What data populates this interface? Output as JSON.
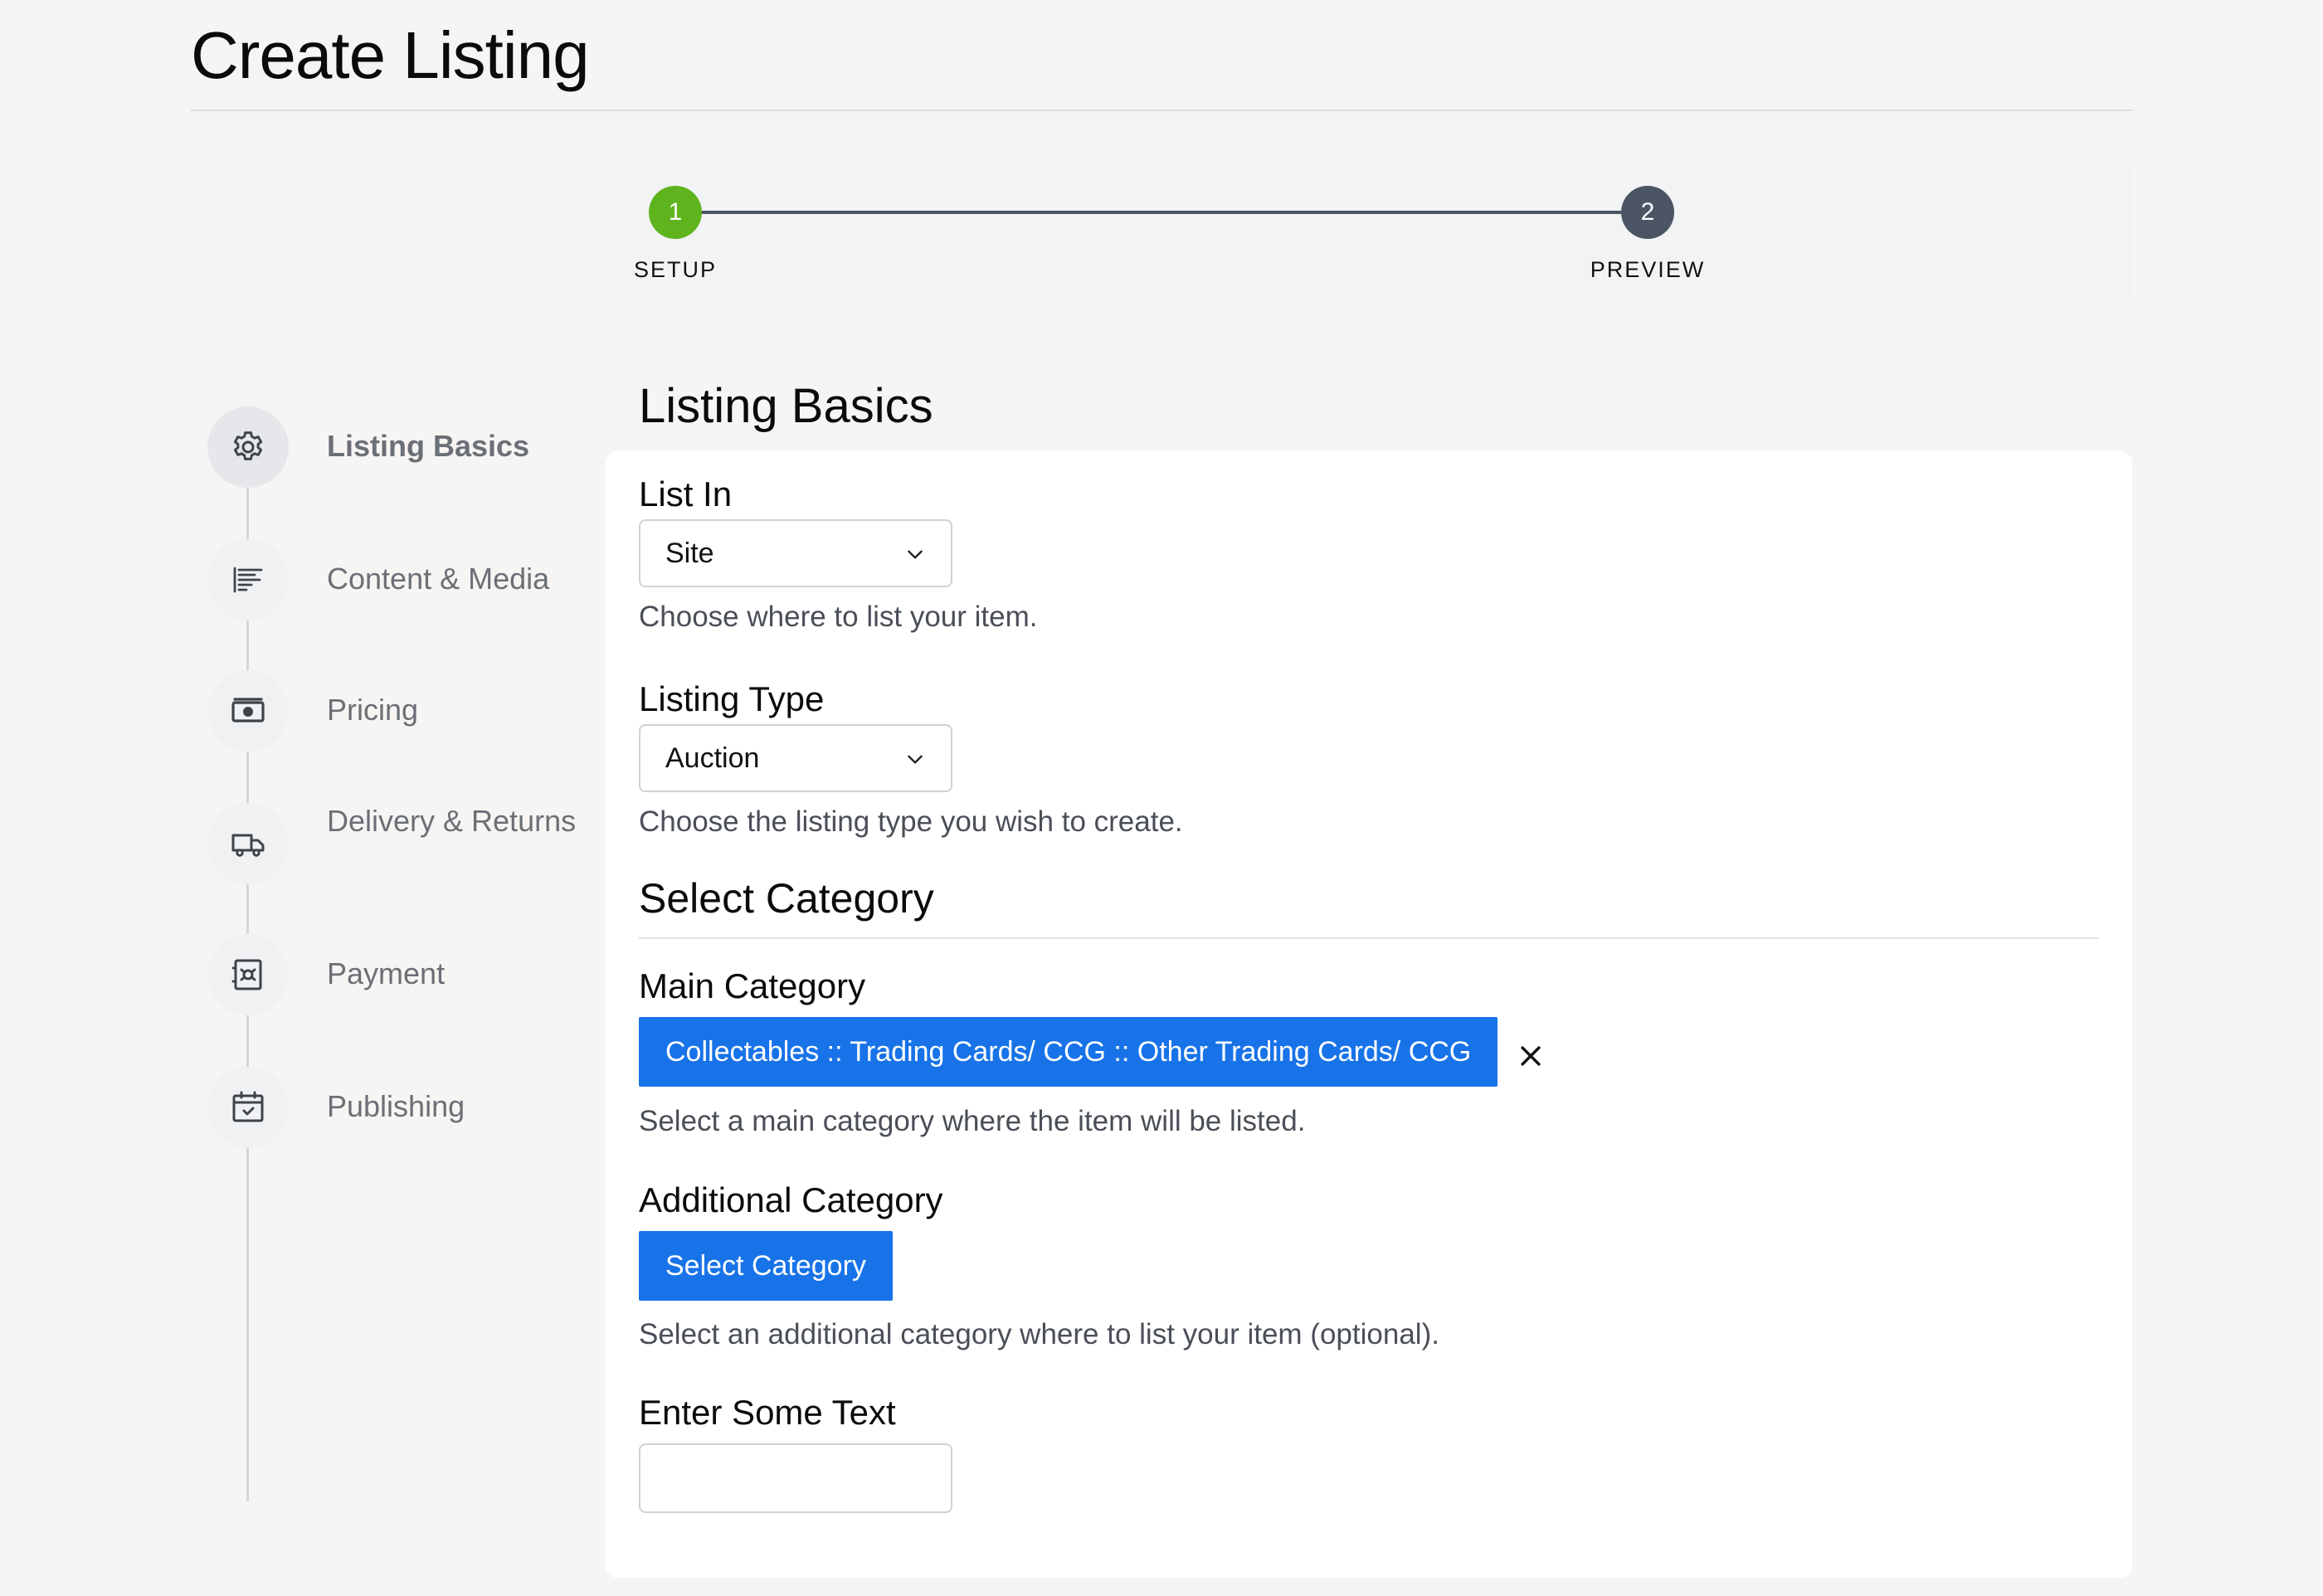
{
  "page": {
    "title": "Create Listing"
  },
  "stepper": {
    "steps": [
      {
        "number": "1",
        "label": "SETUP",
        "status": "current",
        "color": "#5fb41d"
      },
      {
        "number": "2",
        "label": "PREVIEW",
        "status": "upcoming",
        "color": "#4b5563"
      }
    ]
  },
  "sidebar": {
    "items": [
      {
        "label": "Listing Basics",
        "icon": "gear-icon",
        "active": true
      },
      {
        "label": "Content & Media",
        "icon": "text-align-icon",
        "active": false
      },
      {
        "label": "Pricing",
        "icon": "banknote-icon",
        "active": false
      },
      {
        "label": "Delivery & Returns",
        "icon": "truck-icon",
        "active": false
      },
      {
        "label": "Payment",
        "icon": "safe-icon",
        "active": false
      },
      {
        "label": "Publishing",
        "icon": "calendar-check-icon",
        "active": false
      }
    ]
  },
  "main": {
    "section_title": "Listing Basics",
    "list_in": {
      "label": "List In",
      "value": "Site",
      "help": "Choose where to list your item."
    },
    "listing_type": {
      "label": "Listing Type",
      "value": "Auction",
      "help": "Choose the listing type you wish to create."
    },
    "select_category": {
      "title": "Select Category",
      "main_category": {
        "label": "Main Category",
        "value": "Collectables :: Trading Cards/ CCG :: Other Trading Cards/ CCG",
        "clear_icon": "close-icon",
        "help": "Select a main category where the item will be listed."
      },
      "additional_category": {
        "label": "Additional Category",
        "button_label": "Select Category",
        "help": "Select an additional category where to list your item (optional)."
      }
    },
    "enter_text": {
      "label": "Enter Some Text",
      "value": ""
    }
  },
  "colors": {
    "accent": "#1873e8",
    "step_complete": "#5fb41d",
    "step_pending": "#4b5563",
    "background": "#f6f5f3"
  }
}
